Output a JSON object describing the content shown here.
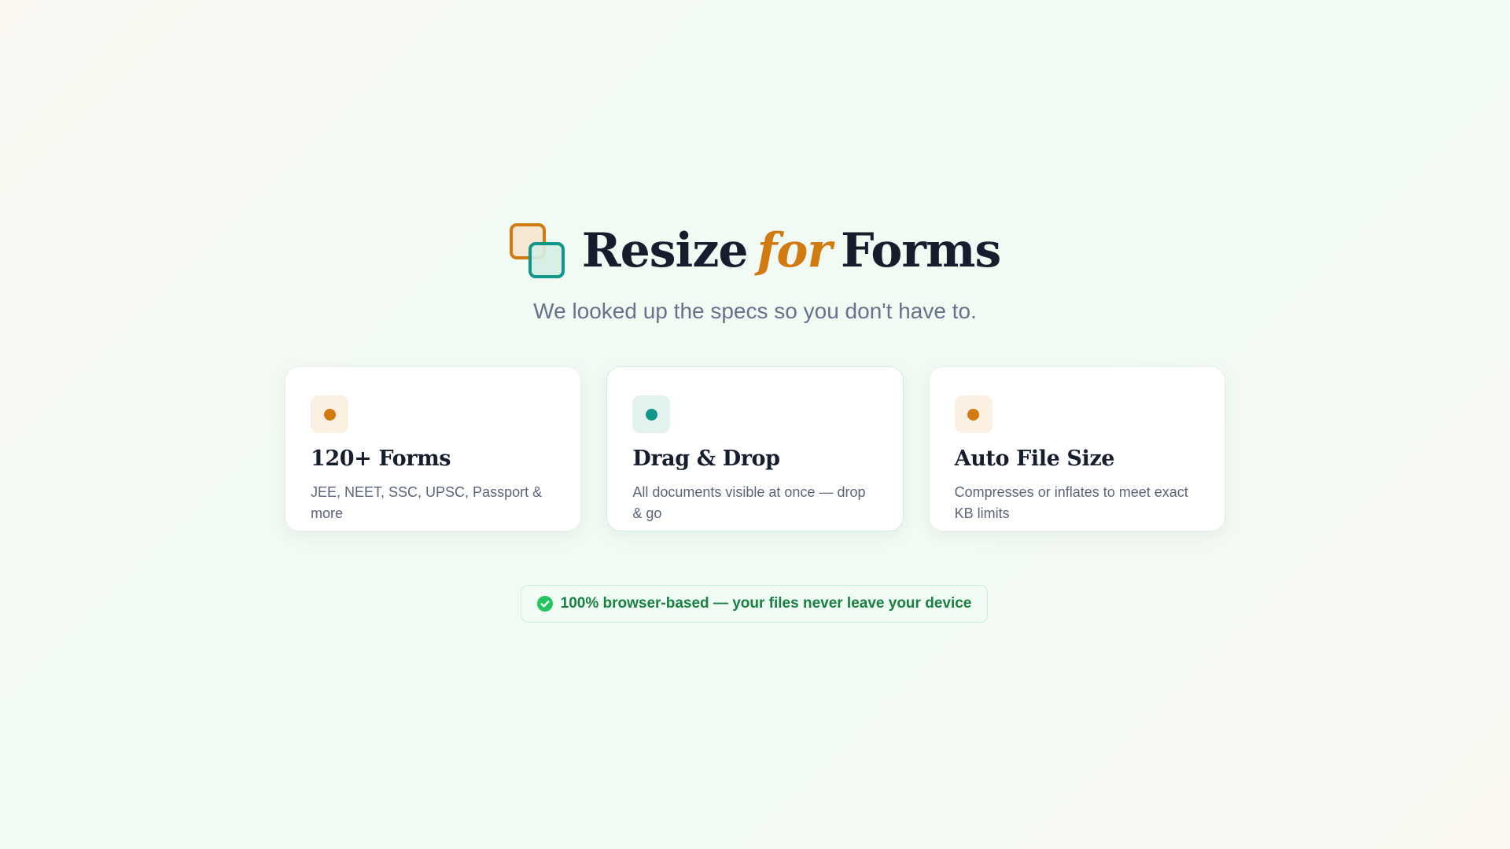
{
  "header": {
    "title_part1": "Resize",
    "title_accent": "for",
    "title_part2": "Forms",
    "subtitle": "We looked up the specs so you don't have to."
  },
  "features": [
    {
      "title": "120+ Forms",
      "description": "JEE, NEET, SSC, UPSC, Passport & more",
      "accent": "#d27a12"
    },
    {
      "title": "Drag & Drop",
      "description": "All documents visible at once — drop & go",
      "accent": "#13968a"
    },
    {
      "title": "Auto File Size",
      "description": "Compresses or inflates to meet exact KB limits",
      "accent": "#d27a12"
    }
  ],
  "privacy": {
    "text": "100% browser-based — your files never leave your device",
    "icon": "check-circle-icon",
    "color": "#188040"
  },
  "colors": {
    "orange": "#d27a12",
    "teal": "#13968a",
    "green": "#22c55e"
  }
}
